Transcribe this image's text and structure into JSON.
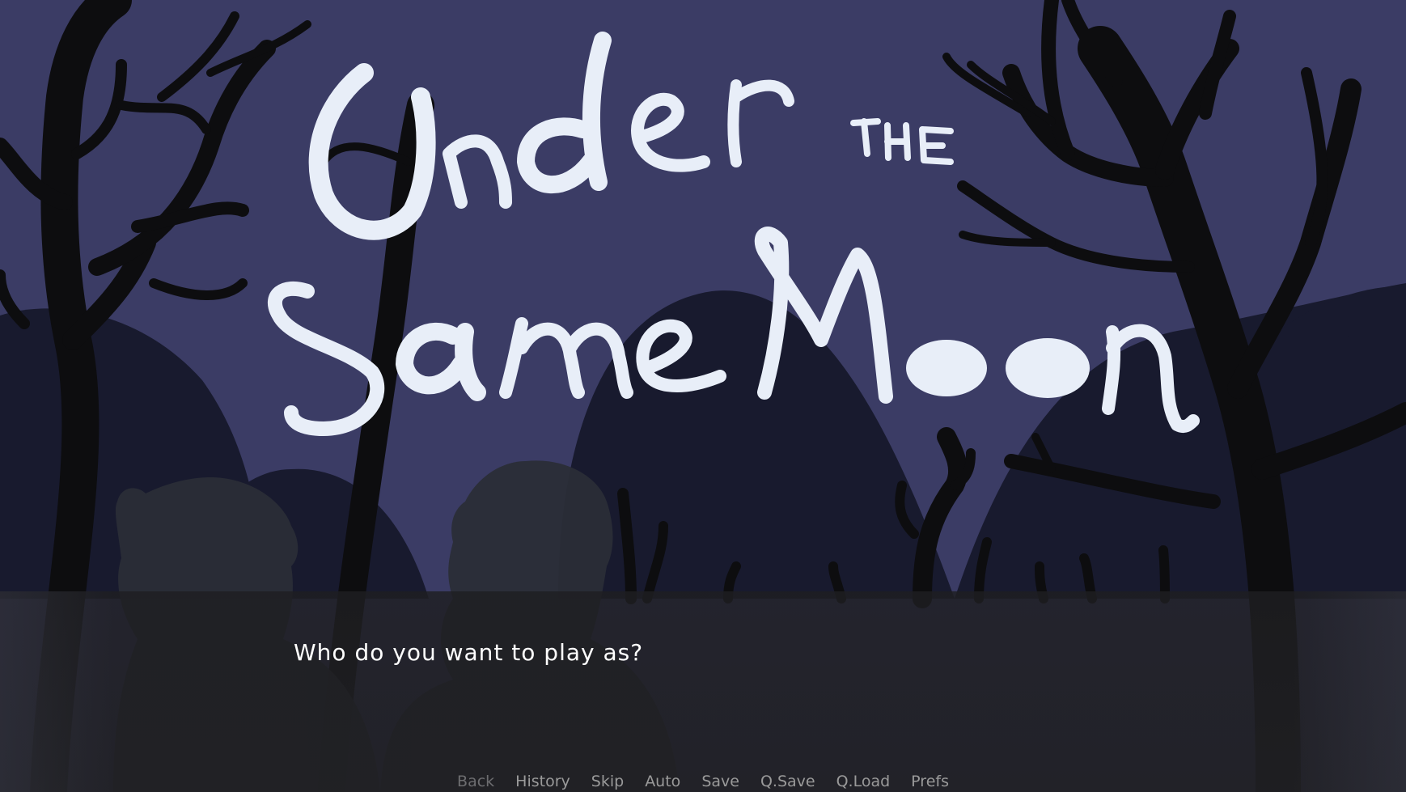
{
  "game": {
    "title_logo": "Under the Same Moon"
  },
  "dialogue": {
    "text": "Who do you want to play as?"
  },
  "quick_menu": {
    "items": [
      {
        "label": "Back",
        "enabled": false
      },
      {
        "label": "History",
        "enabled": true
      },
      {
        "label": "Skip",
        "enabled": true
      },
      {
        "label": "Auto",
        "enabled": true
      },
      {
        "label": "Save",
        "enabled": true
      },
      {
        "label": "Q.Save",
        "enabled": true
      },
      {
        "label": "Q.Load",
        "enabled": true
      },
      {
        "label": "Prefs",
        "enabled": true
      }
    ]
  },
  "colors": {
    "sky": "#3b3c65",
    "hills": "#181a2e",
    "trees": "#0d0d0f",
    "characters": "#2a2d37",
    "logo": "#e8eef8",
    "menu_text": "#9a9a9a",
    "menu_disabled": "#6d6d70",
    "dialogue_text": "#ffffff"
  }
}
